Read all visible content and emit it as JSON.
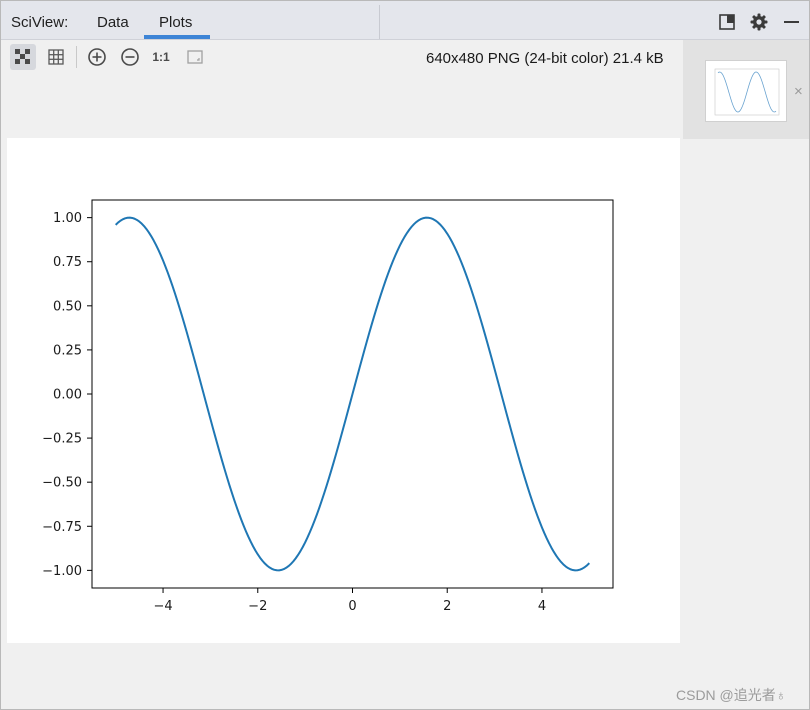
{
  "header": {
    "title": "SciView:",
    "tabs": [
      {
        "label": "Data",
        "selected": false
      },
      {
        "label": "Plots",
        "selected": true
      }
    ],
    "icons": [
      "restore-icon",
      "gear-icon",
      "minimize-icon"
    ]
  },
  "toolbar": {
    "buttons": [
      "checkerboard-icon",
      "grid-icon",
      "zoom-in-icon",
      "zoom-out-icon",
      "actual-size-icon",
      "fit-icon"
    ],
    "actual_size_label": "1:1",
    "image_info": "640x480 PNG (24-bit color) 21.4 kB"
  },
  "thumbnail": {
    "close_label": "×"
  },
  "watermark": "CSDN @追光者♁",
  "chart_data": {
    "type": "line",
    "function": "sin(x)",
    "title": "",
    "xlabel": "",
    "ylabel": "",
    "xlim": [
      -5.5,
      5.5
    ],
    "ylim": [
      -1.1,
      1.1
    ],
    "x_range": [
      -5,
      5
    ],
    "x_ticks": [
      -4,
      -2,
      0,
      2,
      4
    ],
    "x_tick_labels": [
      "−4",
      "−2",
      "0",
      "2",
      "4"
    ],
    "y_ticks": [
      -1.0,
      -0.75,
      -0.5,
      -0.25,
      0.0,
      0.25,
      0.5,
      0.75,
      1.0
    ],
    "y_tick_labels": [
      "−1.00",
      "−0.75",
      "−0.50",
      "−0.25",
      "0.00",
      "0.25",
      "0.50",
      "0.75",
      "1.00"
    ],
    "series": [
      {
        "color": "#1f77b4",
        "x": [
          -5.0,
          -4.5,
          -4.0,
          -3.5,
          -3.0,
          -2.5,
          -2.0,
          -1.5,
          -1.0,
          -0.5,
          0.0,
          0.5,
          1.0,
          1.5,
          2.0,
          2.5,
          3.0,
          3.5,
          4.0,
          4.5,
          5.0
        ],
        "y": [
          0.959,
          0.978,
          0.757,
          0.351,
          -0.141,
          -0.598,
          -0.909,
          -0.997,
          -0.841,
          -0.479,
          0.0,
          0.479,
          0.841,
          0.997,
          0.909,
          0.598,
          0.141,
          -0.351,
          -0.757,
          -0.978,
          -0.959
        ]
      }
    ],
    "grid": false,
    "legend": "none"
  }
}
